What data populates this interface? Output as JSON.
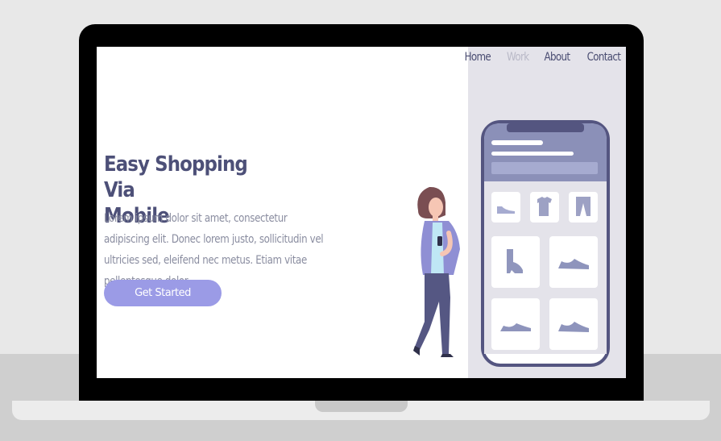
{
  "nav": {
    "items": [
      {
        "label": "Home",
        "active": false
      },
      {
        "label": "Work",
        "active": true
      },
      {
        "label": "About",
        "active": false
      },
      {
        "label": "Contact",
        "active": false
      }
    ]
  },
  "hero": {
    "title_line1": "Easy Shopping Via",
    "title_line2": "Mobile",
    "description": "Lorem ipsum dolor sit amet, consectetur adipiscing elit. Donec lorem justo, sollicitudin vel ultricies sed, eleifend nec metus. Etiam vitae pellentesque dolor.",
    "cta_label": "Get Started"
  },
  "illustration": {
    "products": [
      "flat-shoe-icon",
      "tshirt-icon",
      "pants-icon",
      "boot-icon",
      "sneaker-icon",
      "sneaker-icon",
      "sneaker-icon"
    ]
  },
  "colors": {
    "accent": "#9b9be6",
    "heading": "#4d5078",
    "body_text": "#8a8da0",
    "panel": "#e4e3ea",
    "phone_frame": "#545580"
  }
}
